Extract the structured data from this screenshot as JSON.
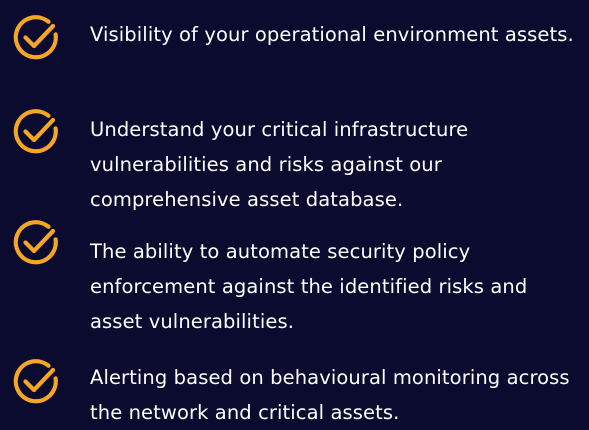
{
  "theme": {
    "background": "#0b0b30",
    "accent": "#f5a623",
    "text_color": "#ffffff"
  },
  "benefits": [
    {
      "icon": "check-circle-icon",
      "text": "Visibility of your operational environment assets."
    },
    {
      "icon": "check-circle-icon",
      "text": "Understand your critical infrastructure vulnerabilities and risks against our comprehensive asset database."
    },
    {
      "icon": "check-circle-icon",
      "text": "The ability to automate security policy enforcement against the identified risks and asset vulnerabilities."
    },
    {
      "icon": "check-circle-icon",
      "text": "Alerting based on behavioural monitoring across the network and critical assets."
    }
  ]
}
